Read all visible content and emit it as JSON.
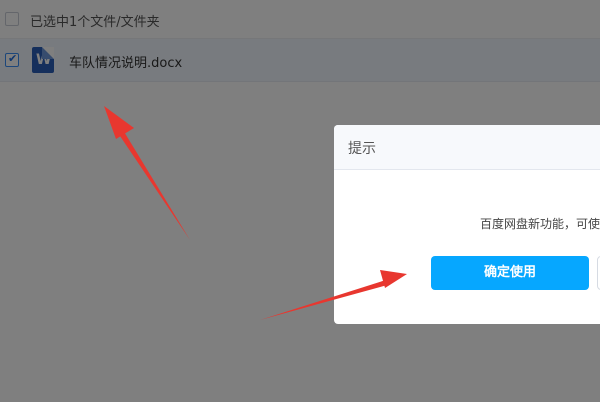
{
  "file_list": {
    "selection_summary": "已选中1个文件/文件夹",
    "files": [
      {
        "name": "车队情况说明.docx",
        "type_icon": "word-document-icon",
        "icon_letter": "W",
        "checked": true
      }
    ]
  },
  "dialog": {
    "title": "提示",
    "message": "百度网盘新功能，可使",
    "confirm_label": "确定使用"
  },
  "colors": {
    "accent": "#06a7ff",
    "annotation_arrow": "#e8372f",
    "word_blue": "#2b5fb9"
  }
}
